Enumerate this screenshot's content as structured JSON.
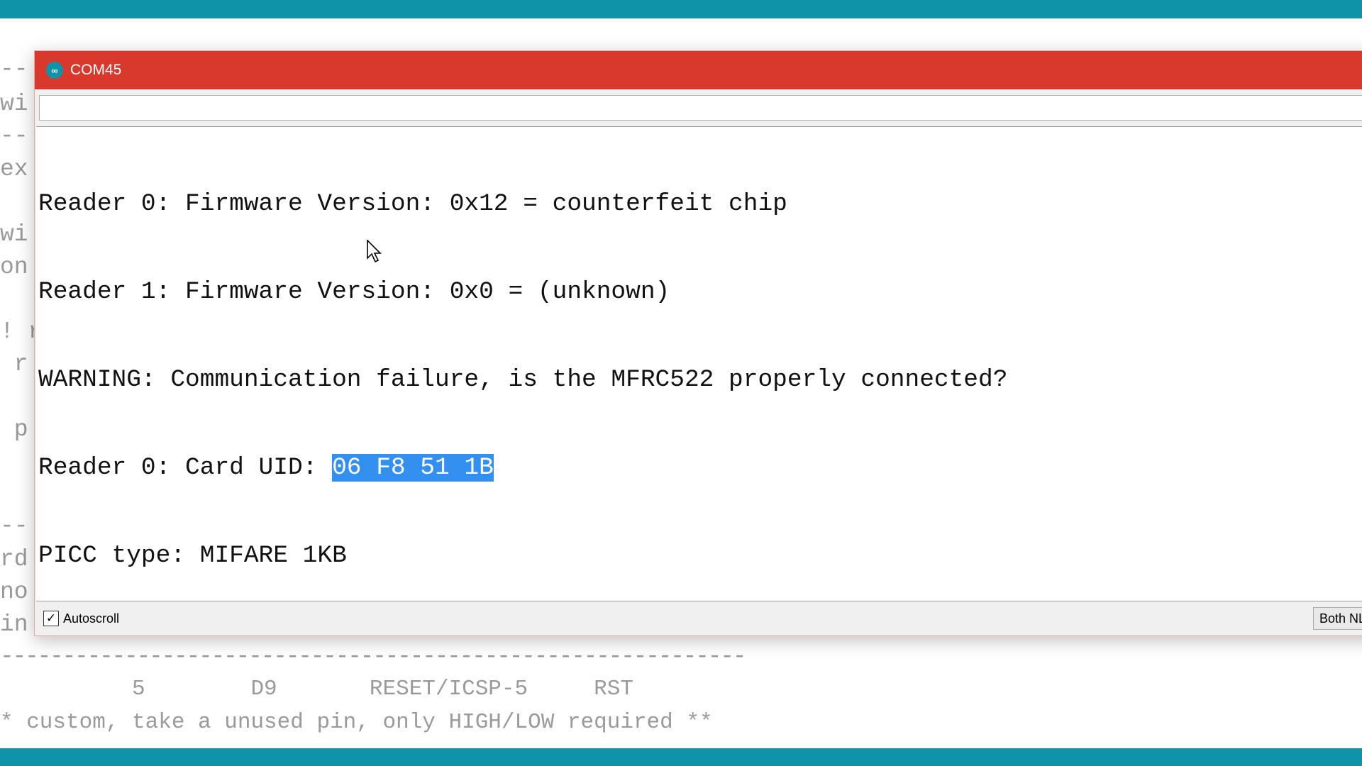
{
  "window": {
    "title": "COM45",
    "icon": "arduino-logo-icon",
    "input_value": "",
    "output_lines": [
      {
        "text": "Reader 0: Firmware Version: 0x12 = counterfeit chip"
      },
      {
        "text": "Reader 1: Firmware Version: 0x0 = (unknown)"
      },
      {
        "text": "WARNING: Communication failure, is the MFRC522 properly connected?"
      },
      {
        "text": "Reader 0: Card UID: ",
        "selected": "06 F8 51 1B"
      },
      {
        "text": "PICC type: MIFARE 1KB"
      }
    ],
    "autoscroll": {
      "label": "Autoscroll",
      "checked": true
    },
    "line_ending": "Both NL"
  },
  "background_editor": {
    "left_fragments": [
      "--",
      "wi",
      "--",
      "ex",
      "wi",
      "on",
      "! r",
      " r",
      " p",
      "--",
      "rd",
      "no",
      "in"
    ],
    "lines": [
      "------------------------------------------------------------",
      "          5        D9       RESET/ICSP-5     RST",
      "* custom, take a unused pin, only HIGH/LOW required **"
    ]
  },
  "colors": {
    "title_bar": "#d9382c",
    "accent": "#0e93a8",
    "selection": "#3390f0"
  }
}
